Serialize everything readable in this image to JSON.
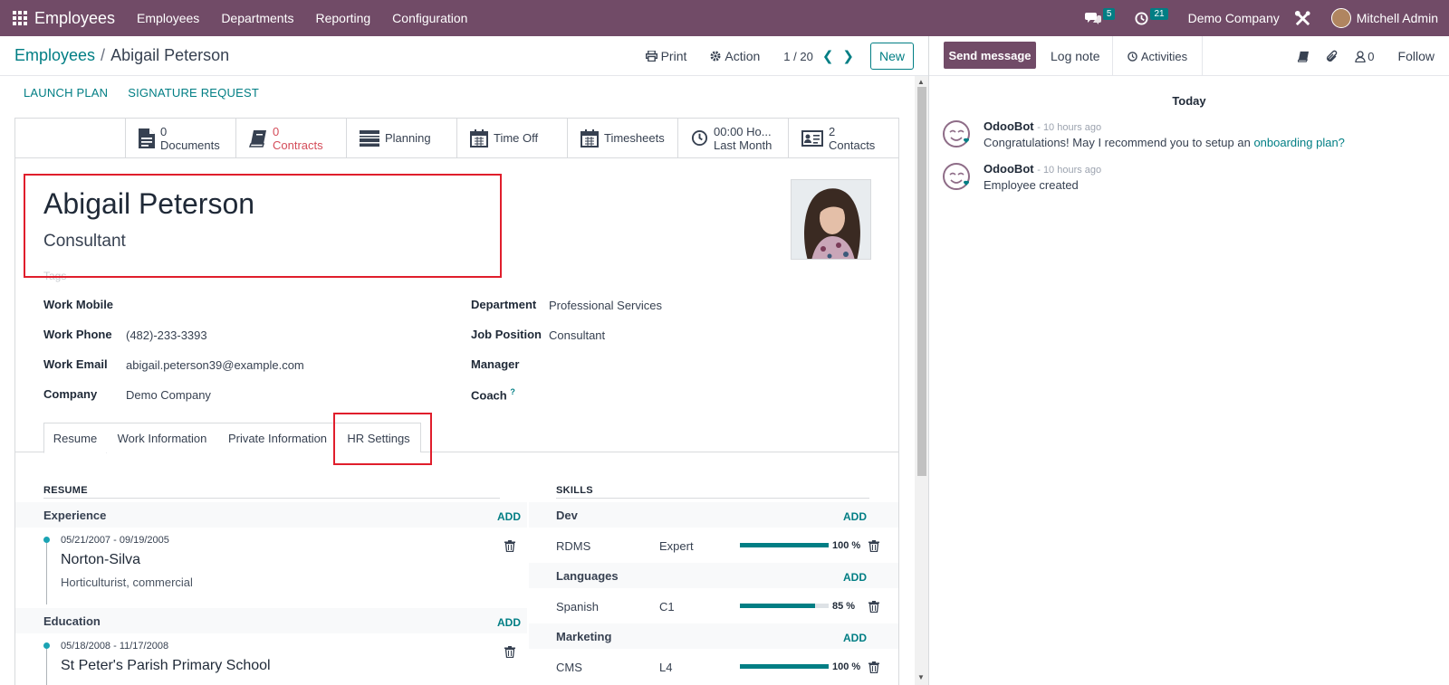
{
  "navbar": {
    "app_name": "Employees",
    "menu": [
      "Employees",
      "Departments",
      "Reporting",
      "Configuration"
    ],
    "messages_count": "5",
    "activities_count": "21",
    "company": "Demo Company",
    "user": "Mitchell Admin"
  },
  "control_panel": {
    "breadcrumb_parent": "Employees",
    "breadcrumb_separator": "/",
    "breadcrumb_current": "Abigail Peterson",
    "print_label": "Print",
    "action_label": "Action",
    "pager": "1 / 20",
    "new_label": "New"
  },
  "statusbar": {
    "launch_plan": "LAUNCH PLAN",
    "signature_request": "SIGNATURE REQUEST"
  },
  "smart_buttons": [
    {
      "value": "0",
      "label": "Documents",
      "icon": "document-icon"
    },
    {
      "value": "0",
      "label": "Contracts",
      "icon": "book-icon"
    },
    {
      "value": "",
      "label": "Planning",
      "icon": "planning-icon"
    },
    {
      "value": "",
      "label": "Time Off",
      "icon": "calendar-icon"
    },
    {
      "value": "",
      "label": "Timesheets",
      "icon": "calendar-icon"
    },
    {
      "value": "00:00 Ho...",
      "label": "Last Month",
      "icon": "clock-icon"
    },
    {
      "value": "2",
      "label": "Contacts",
      "icon": "contact-card-icon"
    }
  ],
  "employee": {
    "name": "Abigail Peterson",
    "job_title": "Consultant",
    "tags_placeholder": "Tags"
  },
  "fields_left": [
    {
      "label": "Work Mobile",
      "value": ""
    },
    {
      "label": "Work Phone",
      "value": "(482)-233-3393"
    },
    {
      "label": "Work Email",
      "value": "abigail.peterson39@example.com"
    },
    {
      "label": "Company",
      "value": "Demo Company"
    }
  ],
  "fields_right": [
    {
      "label": "Department",
      "value": "Professional Services"
    },
    {
      "label": "Job Position",
      "value": "Consultant"
    },
    {
      "label": "Manager",
      "value": ""
    },
    {
      "label": "Coach",
      "value": ""
    }
  ],
  "coach_help": "?",
  "tabs": [
    "Resume",
    "Work Information",
    "Private Information",
    "HR Settings"
  ],
  "resume": {
    "heading": "RESUME",
    "add_label": "ADD",
    "groups": [
      {
        "name": "Experience",
        "entries": [
          {
            "dates": "05/21/2007 - 09/19/2005",
            "title": "Norton-Silva",
            "description": "Horticulturist, commercial"
          }
        ]
      },
      {
        "name": "Education",
        "entries": [
          {
            "dates": "05/18/2008 - 11/17/2008",
            "title": "St Peter's Parish Primary School",
            "description": ""
          }
        ]
      }
    ]
  },
  "skills": {
    "heading": "SKILLS",
    "add_label": "ADD",
    "groups": [
      {
        "name": "Dev",
        "skills": [
          {
            "name": "RDMS",
            "level": "Expert",
            "progress": 100,
            "pct_label": "100 %"
          }
        ]
      },
      {
        "name": "Languages",
        "skills": [
          {
            "name": "Spanish",
            "level": "C1",
            "progress": 85,
            "pct_label": "85 %"
          }
        ]
      },
      {
        "name": "Marketing",
        "skills": [
          {
            "name": "CMS",
            "level": "L4",
            "progress": 100,
            "pct_label": "100 %"
          }
        ]
      }
    ]
  },
  "chatter": {
    "send_message": "Send message",
    "log_note": "Log note",
    "activities": "Activities",
    "followers_count": "0",
    "follow": "Follow",
    "today": "Today",
    "messages": [
      {
        "author": "OdooBot",
        "time": "- 10 hours ago",
        "body": "Congratulations! May I recommend you to setup an ",
        "link": "onboarding plan?"
      },
      {
        "author": "OdooBot",
        "time": "- 10 hours ago",
        "body": "Employee created",
        "link": ""
      }
    ]
  },
  "colors": {
    "brand": "#714b67",
    "accent": "#017e84",
    "highlight": "#e01e2c",
    "danger": "#d44c59"
  }
}
